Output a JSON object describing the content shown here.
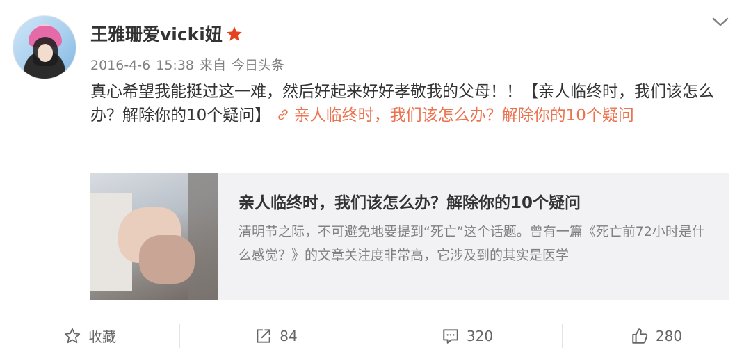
{
  "user": {
    "name": "王雅珊爱vicki妞",
    "badge_color": "#e5421f"
  },
  "meta": {
    "date": "2016-4-6",
    "time": "15:38",
    "from_label": "来自",
    "source": "今日头条"
  },
  "post": {
    "text": "真心希望我能挺过这一难，然后好起来好好孝敬我的父母！！【亲人临终时，我们该怎么办？解除你的10个疑问】",
    "link_text": "亲人临终时，我们该怎么办？解除你的10个疑问",
    "link_color": "#eb7350"
  },
  "card": {
    "title": "亲人临终时，我们该怎么办？解除你的10个疑问",
    "description": "清明节之际，不可避免地要提到“死亡”这个话题。曾有一篇《死亡前72小时是什么感觉？》的文章关注度非常高，它涉及到的其实是医学"
  },
  "actions": {
    "favorite_label": "收藏",
    "repost_count": "84",
    "comment_count": "320",
    "like_count": "280"
  },
  "icons": {
    "vip": "star-icon",
    "menu": "chevron-down-icon",
    "link": "link-icon",
    "favorite": "star-outline-icon",
    "repost": "share-icon",
    "comment": "comment-icon",
    "like": "thumbs-up-icon"
  }
}
